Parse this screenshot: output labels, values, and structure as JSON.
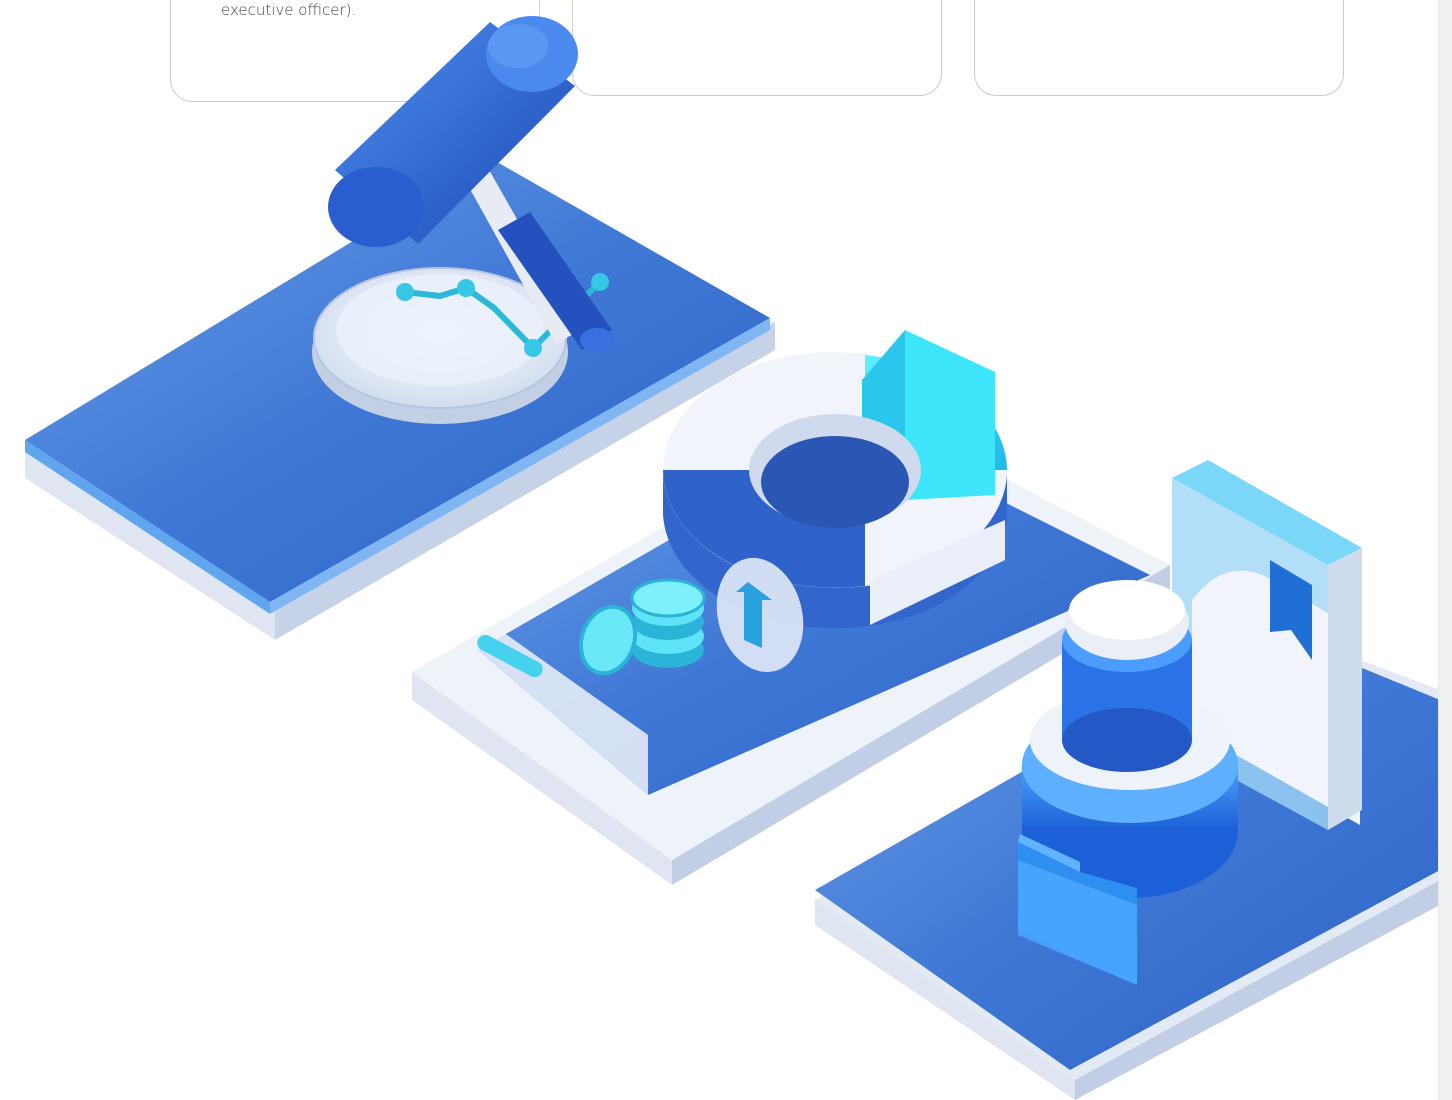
{
  "cards": [
    {
      "text": "executive officer)."
    },
    {
      "text": ""
    },
    {
      "text": ""
    }
  ],
  "illustration": {
    "subject": "isometric-governance-finance-illustration",
    "icons": [
      "gavel-icon",
      "chart-icon",
      "donut-chart-icon",
      "coins-icon",
      "arrow-up-icon",
      "stamp-icon",
      "folder-icon",
      "document-icon",
      "bookmark-icon"
    ]
  },
  "colors": {
    "primary_blue": "#3b74d4",
    "dark_blue": "#2a58b8",
    "cyan": "#38dcf5",
    "light_panel": "#e6ecf6",
    "card_border": "#c9ccd2"
  }
}
